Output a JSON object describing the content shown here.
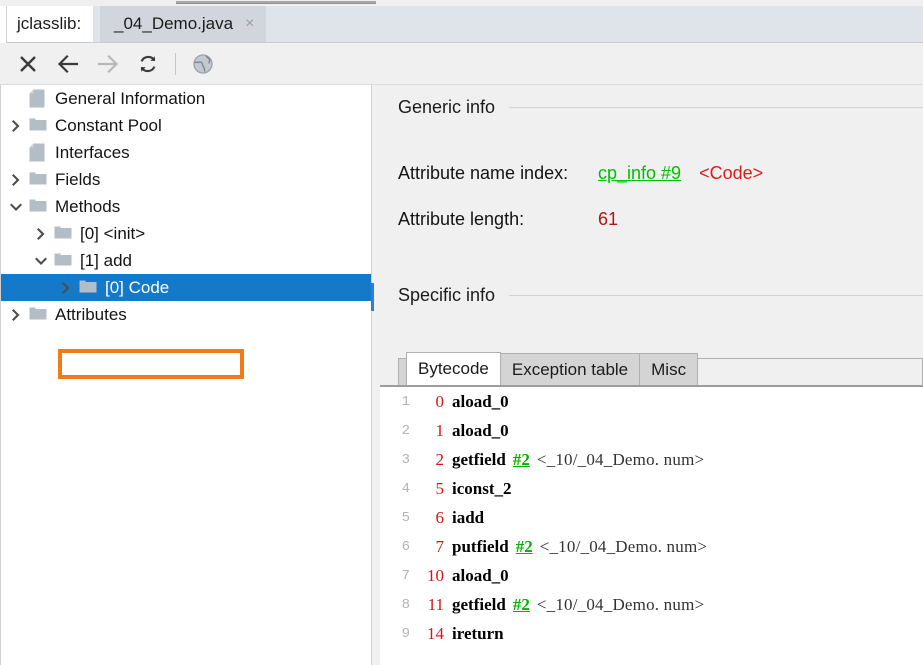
{
  "titlebar": {
    "app_label": "jclasslib:",
    "tab_title": "_04_Demo.java",
    "close_glyph": "×"
  },
  "toolbar": {
    "buttons": [
      {
        "name": "close-icon",
        "label": "Close",
        "enabled": true
      },
      {
        "name": "back-icon",
        "label": "Back",
        "enabled": true
      },
      {
        "name": "forward-icon",
        "label": "Forward",
        "enabled": false
      },
      {
        "name": "reload-icon",
        "label": "Reload",
        "enabled": true
      },
      {
        "name": "browse-icon",
        "label": "Browse",
        "enabled": true
      }
    ]
  },
  "tree": {
    "nodes": [
      {
        "label": "General Information",
        "icon": "document-icon",
        "depth": 0,
        "twisty": "none",
        "selected": false
      },
      {
        "label": "Constant Pool",
        "icon": "folder-icon",
        "depth": 0,
        "twisty": "collapsed",
        "selected": false
      },
      {
        "label": "Interfaces",
        "icon": "document-icon",
        "depth": 0,
        "twisty": "none",
        "selected": false
      },
      {
        "label": "Fields",
        "icon": "folder-icon",
        "depth": 0,
        "twisty": "collapsed",
        "selected": false
      },
      {
        "label": "Methods",
        "icon": "folder-icon",
        "depth": 0,
        "twisty": "expanded",
        "selected": false
      },
      {
        "label": "[0] <init>",
        "icon": "folder-icon",
        "depth": 1,
        "twisty": "collapsed",
        "selected": false
      },
      {
        "label": "[1] add",
        "icon": "folder-icon",
        "depth": 1,
        "twisty": "expanded",
        "selected": false
      },
      {
        "label": "[0] Code",
        "icon": "folder-icon",
        "depth": 2,
        "twisty": "collapsed",
        "selected": true
      },
      {
        "label": "Attributes",
        "icon": "folder-icon",
        "depth": 0,
        "twisty": "collapsed",
        "selected": false
      }
    ],
    "annotation_color": "#f07c18"
  },
  "detail": {
    "generic_info_heading": "Generic info",
    "specific_info_heading": "Specific info",
    "attribute_name_index_label": "Attribute name index:",
    "attribute_name_index_link": "cp_info #9",
    "attribute_name_index_type": "<Code>",
    "attribute_length_label": "Attribute length:",
    "attribute_length_value": "61",
    "tabs": [
      {
        "label": "Bytecode",
        "active": true
      },
      {
        "label": "Exception table",
        "active": false
      },
      {
        "label": "Misc",
        "active": false
      }
    ]
  },
  "bytecode": {
    "lines": [
      {
        "num": "1",
        "offset": "0",
        "mnemonic": "aload_0",
        "cp": "",
        "descriptor": ""
      },
      {
        "num": "2",
        "offset": "1",
        "mnemonic": "aload_0",
        "cp": "",
        "descriptor": ""
      },
      {
        "num": "3",
        "offset": "2",
        "mnemonic": "getfield",
        "cp": "#2",
        "descriptor": "<_10/_04_Demo. num>"
      },
      {
        "num": "4",
        "offset": "5",
        "mnemonic": "iconst_2",
        "cp": "",
        "descriptor": ""
      },
      {
        "num": "5",
        "offset": "6",
        "mnemonic": "iadd",
        "cp": "",
        "descriptor": ""
      },
      {
        "num": "6",
        "offset": "7",
        "mnemonic": "putfield",
        "cp": "#2",
        "descriptor": "<_10/_04_Demo. num>"
      },
      {
        "num": "7",
        "offset": "10",
        "mnemonic": "aload_0",
        "cp": "",
        "descriptor": ""
      },
      {
        "num": "8",
        "offset": "11",
        "mnemonic": "getfield",
        "cp": "#2",
        "descriptor": "<_10/_04_Demo. num>"
      },
      {
        "num": "9",
        "offset": "14",
        "mnemonic": "ireturn",
        "cp": "",
        "descriptor": ""
      }
    ]
  },
  "colors": {
    "selection_blue": "#1579c9",
    "link_green": "#00c000",
    "type_red": "#e01b1b",
    "number_red": "#b21414",
    "annotation_orange": "#f07c18"
  }
}
